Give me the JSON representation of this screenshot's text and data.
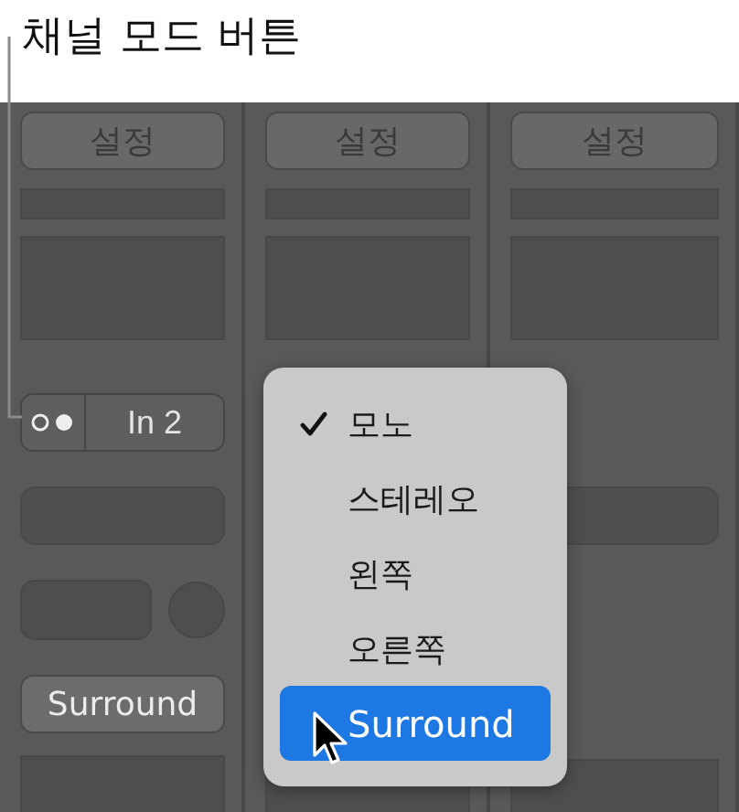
{
  "callout": {
    "label": "채널 모드 버튼"
  },
  "strips": [
    {
      "settings": "설정",
      "input": "In 2",
      "format": "Surround"
    },
    {
      "settings": "설정"
    },
    {
      "settings": "설정"
    }
  ],
  "menu": {
    "items": [
      {
        "label": "모노",
        "checked": true,
        "selected": false
      },
      {
        "label": "스테레오",
        "checked": false,
        "selected": false
      },
      {
        "label": "왼쪽",
        "checked": false,
        "selected": false
      },
      {
        "label": "오른쪽",
        "checked": false,
        "selected": false
      },
      {
        "label": "Surround",
        "checked": false,
        "selected": true
      }
    ]
  }
}
